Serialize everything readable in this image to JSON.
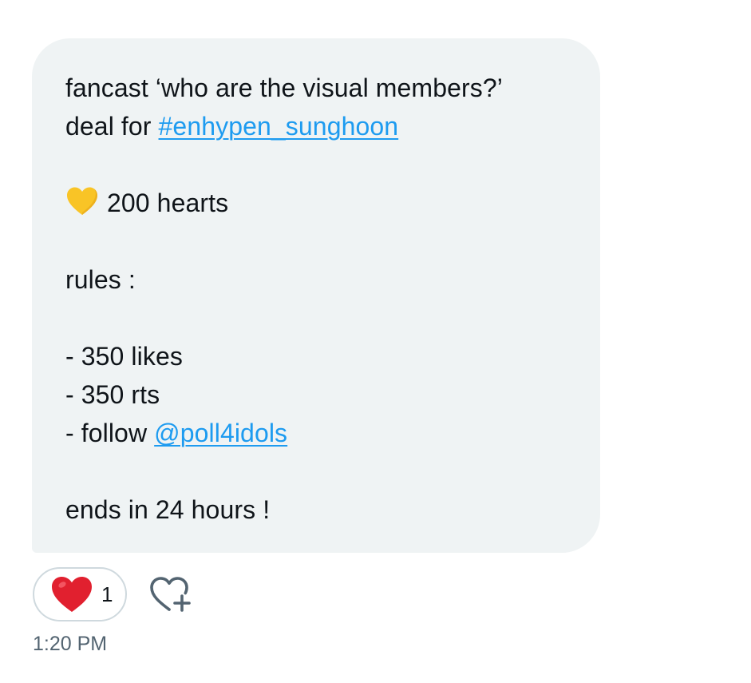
{
  "message": {
    "line1": "fancast ‘who are the visual members?’",
    "line2_prefix": "deal for ",
    "hashtag": "#enhypen_sunghoon",
    "reward": "200 hearts",
    "rules_label": "rules :",
    "rule1": "- 350 likes",
    "rule2": "- 350 rts",
    "rule3_prefix": "- follow ",
    "mention": "@poll4idols",
    "ending": "ends in 24 hours !"
  },
  "reactions": {
    "items": [
      {
        "emoji": "red-heart",
        "count": "1"
      }
    ],
    "add_icon": "add-reaction-heart-plus-icon"
  },
  "timestamp": "1:20 PM",
  "colors": {
    "bubble": "#eff3f4",
    "link": "#1d9bf0",
    "text": "#0f1419",
    "muted": "#536471",
    "yellow_heart": "#f9c426",
    "red_heart": "#e1202f"
  }
}
